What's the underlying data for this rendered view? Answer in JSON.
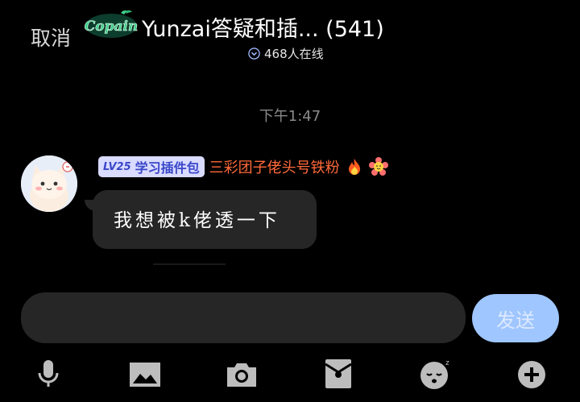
{
  "header": {
    "cancel_label": "取消",
    "title": "Yunzai答疑和插... (541)",
    "logo_text": "Copain",
    "online_count": "468人在线"
  },
  "chat": {
    "timestamp": "下午1:47",
    "message": {
      "level": "LV25",
      "badge_title": "学习插件包",
      "sender": "三彩团子佬头号铁粉",
      "text": "我想被k佬透一下"
    }
  },
  "composer": {
    "input_value": "",
    "send_label": "发送"
  },
  "toolbar": {
    "icons": [
      "microphone-icon",
      "image-icon",
      "camera-icon",
      "red-packet-icon",
      "emoji-icon",
      "plus-icon"
    ]
  },
  "colors": {
    "background": "#000000",
    "bubble": "#262626",
    "sender_name": "#ff6a3a",
    "badge_bg": "#d9dbff",
    "send_button": "#9fc6ff"
  }
}
